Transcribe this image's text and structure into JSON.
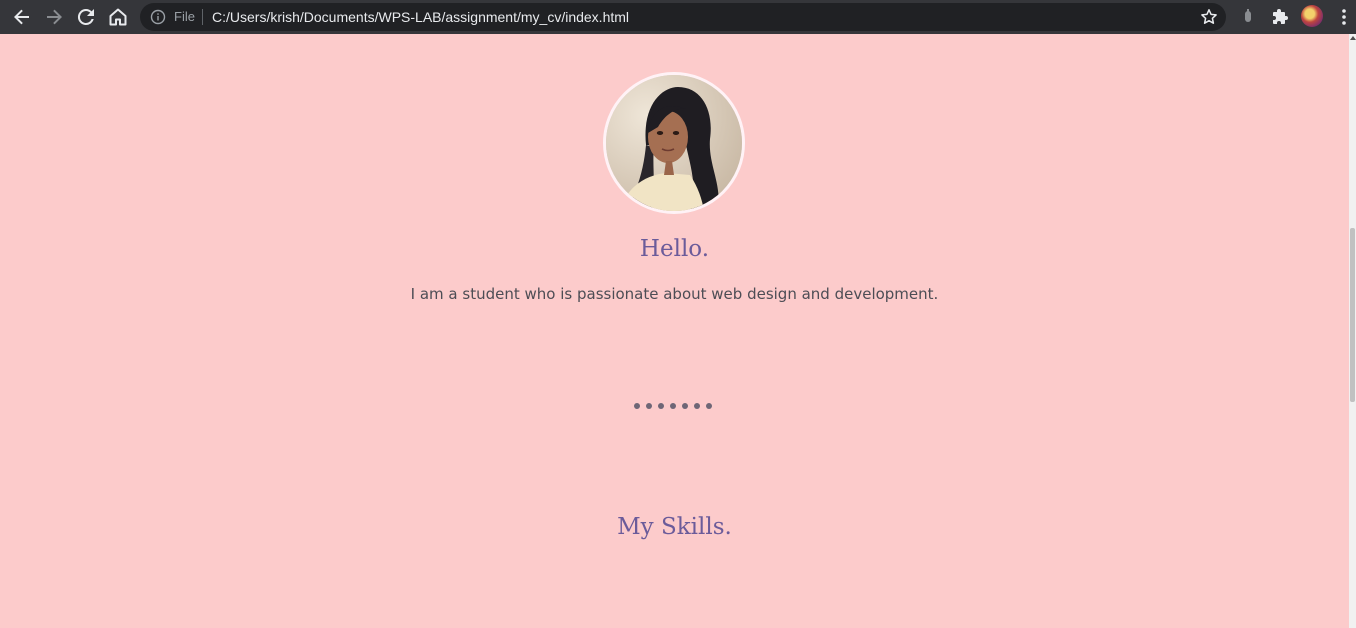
{
  "browser": {
    "address_scheme_label": "File",
    "url": "C:/Users/krish/Documents/WPS-LAB/assignment/my_cv/index.html",
    "icons": [
      "back-arrow-icon",
      "forward-arrow-icon",
      "reload-icon",
      "home-icon",
      "info-icon",
      "star-icon",
      "extension-puzzle-icon",
      "kebab-menu-icon"
    ]
  },
  "page": {
    "greeting": "Hello.",
    "bio": "I am a student who is passionate about web design and development.",
    "skills_heading": "My Skills.",
    "divider_dot_count": 7
  },
  "colors": {
    "background": "#fccbcb",
    "heading": "#6b5b9a",
    "body_text": "#4d4d55",
    "toolbar": "#35363a",
    "omnibox": "#202124"
  }
}
